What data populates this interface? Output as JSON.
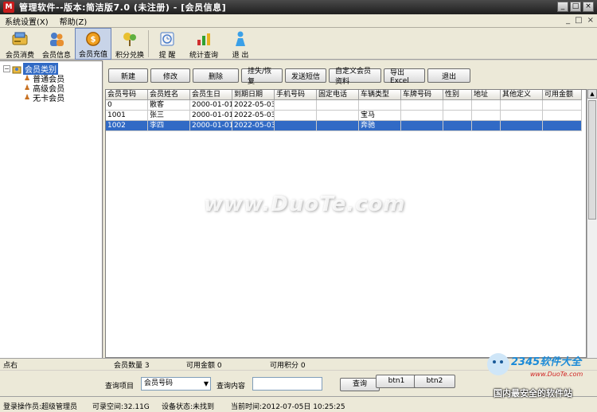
{
  "window": {
    "title": "管理软件--版本:简洁版7.0 (未注册) - [会员信息]",
    "app_icon": "M"
  },
  "menu": {
    "items": [
      "系统设置(X)",
      "帮助(Z)"
    ],
    "right_controls": [
      "_",
      "□",
      "×"
    ]
  },
  "toolbar": {
    "buttons": [
      {
        "label": "会员消费",
        "icon": "card-icon"
      },
      {
        "label": "会员信息",
        "icon": "users-icon"
      },
      {
        "label": "会员充值",
        "icon": "coin-icon",
        "active": true
      },
      {
        "label": "积分兑换",
        "icon": "gift-icon"
      },
      {
        "label": "提 醒",
        "icon": "reminder-icon"
      },
      {
        "label": "统计查询",
        "icon": "chart-icon"
      },
      {
        "label": "退 出",
        "icon": "exit-person-icon"
      }
    ]
  },
  "tree": {
    "root": "会员类别",
    "children": [
      "普通会员",
      "高级会员",
      "无卡会员"
    ]
  },
  "actions": [
    "新建",
    "修改",
    "删除",
    "挂失/恢复",
    "发送短信",
    "自定义会员资料",
    "导出Excel",
    "退出"
  ],
  "grid": {
    "columns": [
      "会员号码",
      "会员姓名",
      "会员生日",
      "到期日期",
      "手机号码",
      "固定电话",
      "车辆类型",
      "车牌号码",
      "性别",
      "地址",
      "其他定义",
      "可用金额"
    ],
    "rows": [
      [
        "0",
        "散客",
        "2000-01-01",
        "2022-05-03",
        "",
        "",
        "",
        "",
        "",
        "",
        "",
        ""
      ],
      [
        "1001",
        "张三",
        "2000-01-01",
        "2022-05-03",
        "",
        "",
        "宝马",
        "",
        "",
        "",
        "",
        ""
      ],
      [
        "1002",
        "李四",
        "2000-01-01",
        "2022-05-03",
        "",
        "",
        "奔驰",
        "",
        "",
        "",
        "",
        ""
      ]
    ],
    "selected_row": 2
  },
  "summary": {
    "left": "点右",
    "member_count": "会员数量 3",
    "available_amount": "可用金额 0",
    "available_points": "可用积分 0"
  },
  "query": {
    "item_label": "查询项目",
    "item_value": "会员号码",
    "content_label": "查询内容",
    "content_value": "",
    "search_button": "查询",
    "btn1": "btn1",
    "btn2": "btn2"
  },
  "status": {
    "operator": "登录操作员:超级管理员",
    "free_space": "可录空间:32.11G",
    "device": "设备状态:未找到",
    "time": "当前时间:2012-07-05日 10:25:25"
  },
  "watermark": {
    "main": "www.DuoTe.com",
    "brand": "2345软件大全",
    "url": "www.DuoTe.com",
    "slogan": "国内最安全的软件站"
  },
  "colors": {
    "selection": "#316ac5",
    "titlebar": "#1e1e1e",
    "panel": "#ece9d8"
  }
}
